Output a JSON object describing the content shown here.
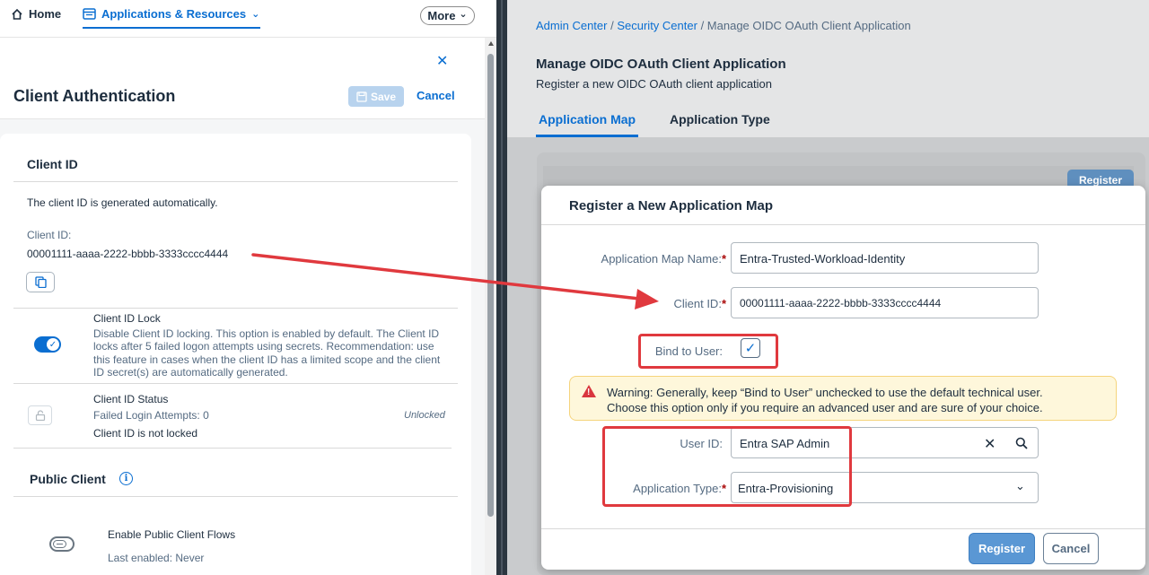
{
  "topnav": {
    "home_label": "Home",
    "apps_label": "Applications & Resources",
    "more_label": "More"
  },
  "dialog": {
    "title": "Client Authentication",
    "save_label": "Save",
    "cancel_label": "Cancel"
  },
  "client_id_section": {
    "title": "Client ID",
    "description": "The client ID is generated automatically.",
    "field_label": "Client ID:",
    "value": "00001111-aaaa-2222-bbbb-3333cccc4444"
  },
  "lock": {
    "title": "Client ID Lock",
    "description": "Disable Client ID locking. This option is enabled by default. The Client ID locks after 5 failed logon attempts using secrets. Recommendation: use this feature in cases when the client ID has a limited scope and the client ID secret(s) are automatically generated.",
    "enabled": true
  },
  "status": {
    "title": "Client ID Status",
    "failed_attempts": "Failed Login Attempts: 0",
    "state_text": "Client ID is not locked",
    "badge": "Unlocked"
  },
  "public_client": {
    "title": "Public Client",
    "flow_label": "Enable Public Client Flows",
    "last_enabled": "Last enabled: Never",
    "enabled": false
  },
  "right_page": {
    "breadcrumb": [
      "Admin Center",
      "Security Center",
      "Manage OIDC OAuth Client Application"
    ],
    "title": "Manage OIDC OAuth Client Application",
    "subtitle": "Register a new OIDC OAuth client application",
    "tabs": [
      "Application Map",
      "Application Type"
    ],
    "bg_button": "Register"
  },
  "modal": {
    "title": "Register a New Application Map",
    "app_map_name_label": "Application Map Name:",
    "app_map_name_value": "Entra-Trusted-Workload-Identity",
    "client_id_label": "Client ID:",
    "client_id_value": "00001111-aaaa-2222-bbbb-3333cccc4444",
    "bind_label": "Bind to User:",
    "bind_checked": true,
    "warning_line1": "Warning: Generally, keep “Bind to User” unchecked to use the default technical user.",
    "warning_line2": "Choose this option only if you require an advanced user and are sure of your choice.",
    "user_id_label": "User ID:",
    "user_id_value": "Entra SAP Admin",
    "app_type_label": "Application Type:",
    "app_type_value": "Entra-Provisioning",
    "register_label": "Register",
    "cancel_label": "Cancel",
    "required_mark": "*"
  },
  "colors": {
    "accent": "#0a6ed1",
    "annotation": "#e0393e",
    "warning_bg": "#fef7db"
  }
}
